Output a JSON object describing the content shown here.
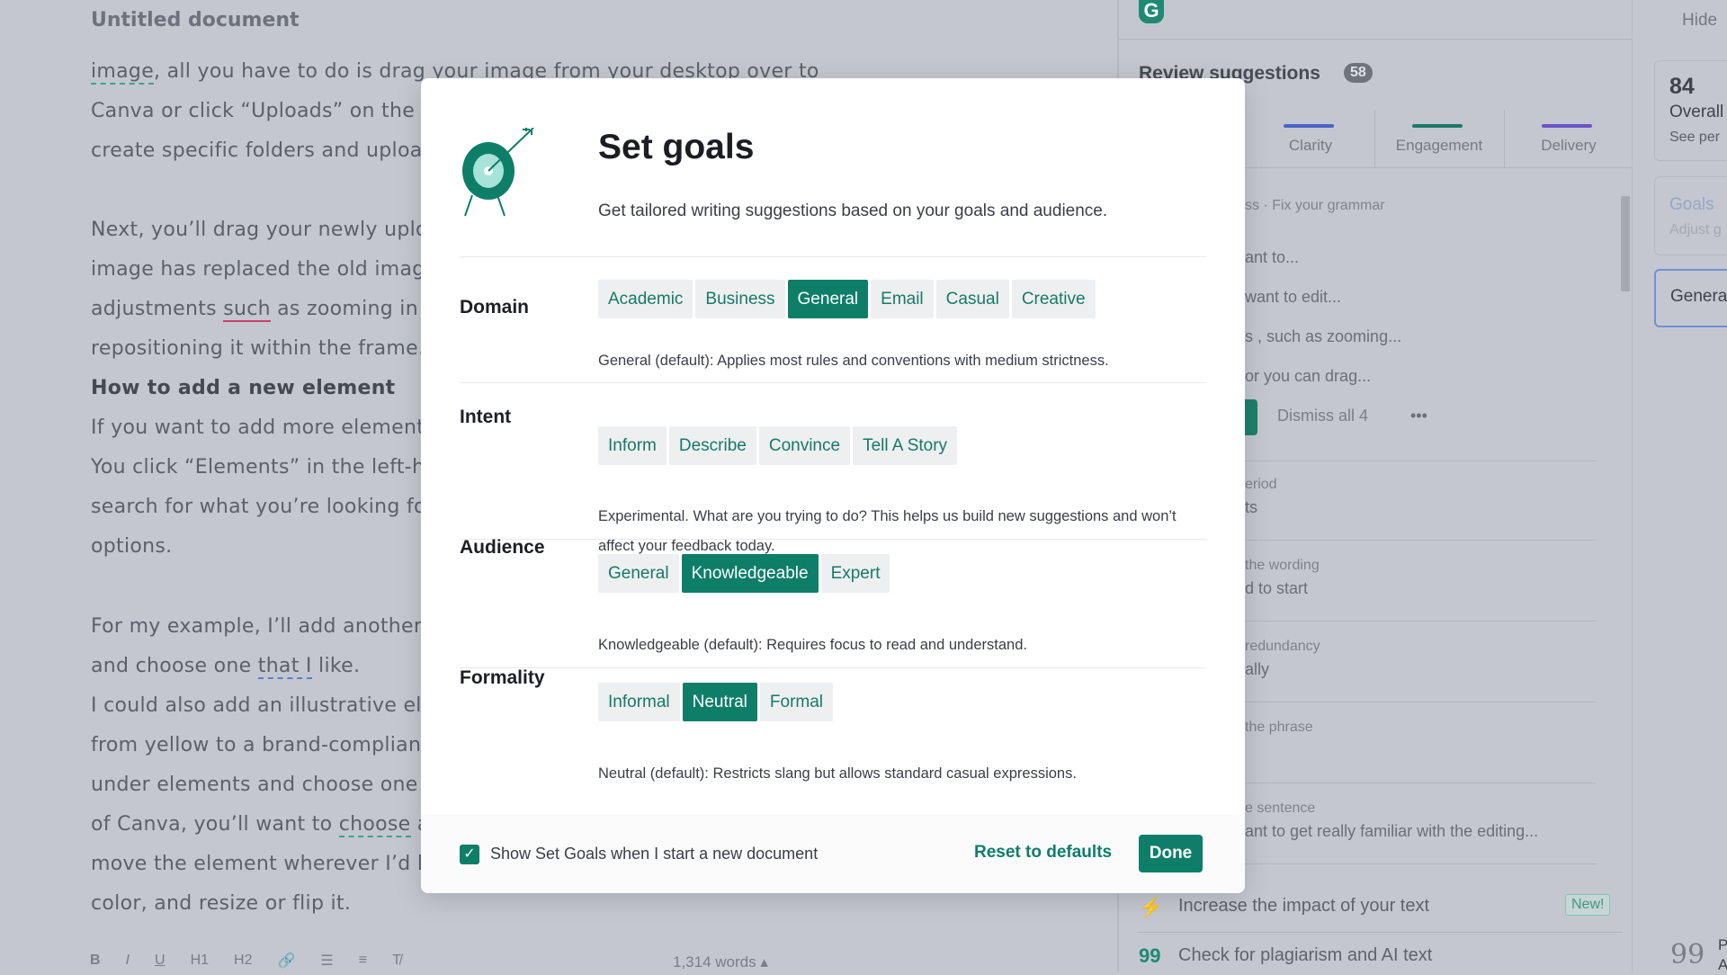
{
  "document": {
    "title": "Untitled document",
    "lines": [
      {
        "pre": "",
        "u": "image",
        "post": ", all you have to do is drag your image from your desktop over to",
        "style": "green"
      },
      {
        "pre": "Canva or click “Uploads” on the l"
      },
      {
        "pre": "create specific folders and uploa"
      },
      {
        "pre": "Next, you’ll drag your newly uplo"
      },
      {
        "pre": "image has replaced the old image"
      },
      {
        "pre": "adjustments ",
        "u": "such",
        "post": " as zooming in o",
        "style": "red"
      },
      {
        "pre": "repositioning it within the frame."
      },
      {
        "pre": "How to add a new element",
        "heading": true
      },
      {
        "pre": "If you want to add more element"
      },
      {
        "pre": "You click “Elements” in the left-ha"
      },
      {
        "pre": "search for what you’re looking for"
      },
      {
        "pre": "options."
      },
      {
        "pre": "For my example, I’ll add another"
      },
      {
        "pre": "and choose one ",
        "u": "that I",
        "post": " like.",
        "style": "blue"
      },
      {
        "pre": "I could also add an illustrative ele"
      },
      {
        "pre": "from yellow to a brand-compliant"
      },
      {
        "pre": "under elements and choose one y"
      },
      {
        "pre": "of Canva, you’ll want to ",
        "u": "choose",
        "post": " a",
        "style": "green"
      },
      {
        "pre": "move the element wherever I’d li"
      },
      {
        "pre": "color, and resize or flip it."
      }
    ],
    "toolbar": [
      "B",
      "I",
      "U",
      "H1",
      "H2",
      "🔗",
      "☰",
      "≡",
      "T̸"
    ],
    "word_count": "1,314 words ▴"
  },
  "review": {
    "logo": "G",
    "title": "Review suggestions",
    "count": "58",
    "tabs": [
      {
        "label": "Clarity",
        "color": "#4a64c8"
      },
      {
        "label": "Engagement",
        "color": "#1d7a68"
      },
      {
        "label": "Delivery",
        "color": "#6a55c8"
      }
    ],
    "suggestions": {
      "header": "ss · Fix your grammar",
      "items": [
        "ant to...",
        "want to edit...",
        "s , such as zooming...",
        "or you can drag..."
      ],
      "dismiss": "Dismiss all 4",
      "more": "•••",
      "cards": [
        {
          "type": "eriod",
          "text": "ts"
        },
        {
          "type": "the wording",
          "text": "d to start"
        },
        {
          "type": "redundancy",
          "text": "ally"
        },
        {
          "type": "the phrase",
          "text": ""
        },
        {
          "type": "e sentence",
          "text": "ant to get really familiar with the editing..."
        }
      ]
    },
    "bottom": [
      {
        "label": "Increase the impact of your text",
        "badge": "New!"
      },
      {
        "label": "Check for plagiarism and AI text"
      }
    ]
  },
  "sidebar": {
    "hide": "Hide",
    "score": "84",
    "overall": "Overall",
    "see": "See per",
    "goals": "Goals",
    "goals_sub": "Adjust g",
    "general": "Genera",
    "bottom_letters": "P A"
  },
  "modal": {
    "title": "Set goals",
    "subtitle": "Get tailored writing suggestions based on your goals and audience.",
    "accent": "#0e7e69",
    "groups": [
      {
        "label": "Domain",
        "options": [
          "Academic",
          "Business",
          "General",
          "Email",
          "Casual",
          "Creative"
        ],
        "selected": "General",
        "desc": "General (default): Applies most rules and conventions with medium strictness."
      },
      {
        "label": "Intent",
        "options": [
          "Inform",
          "Describe",
          "Convince",
          "Tell A Story"
        ],
        "selected": null,
        "desc": "Experimental. What are you trying to do? This helps us build new suggestions and won’t affect your feedback today."
      },
      {
        "label": "Audience",
        "options": [
          "General",
          "Knowledgeable",
          "Expert"
        ],
        "selected": "Knowledgeable",
        "desc": "Knowledgeable (default): Requires focus to read and understand."
      },
      {
        "label": "Formality",
        "options": [
          "Informal",
          "Neutral",
          "Formal"
        ],
        "selected": "Neutral",
        "desc": "Neutral (default): Restricts slang but allows standard casual expressions."
      }
    ],
    "show_checkbox": {
      "label": "Show Set Goals when I start a new document",
      "checked": true
    },
    "reset": "Reset to defaults",
    "done": "Done"
  }
}
